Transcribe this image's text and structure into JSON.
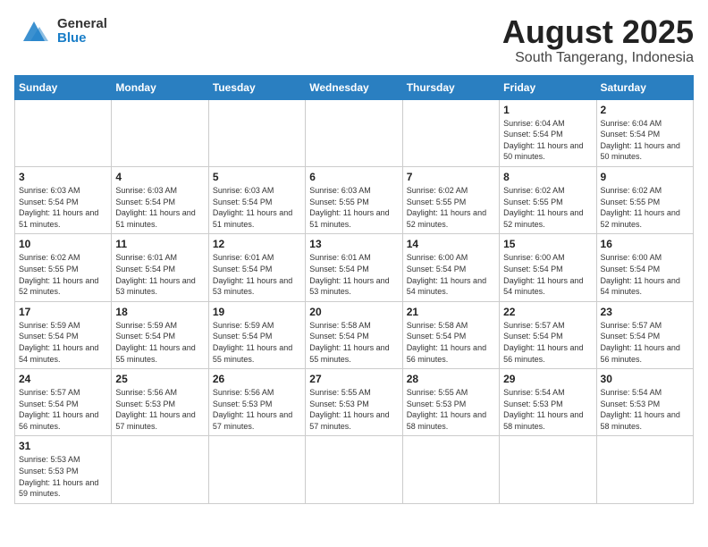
{
  "header": {
    "month": "August 2025",
    "location": "South Tangerang, Indonesia"
  },
  "logo": {
    "general": "General",
    "blue": "Blue"
  },
  "days": [
    "Sunday",
    "Monday",
    "Tuesday",
    "Wednesday",
    "Thursday",
    "Friday",
    "Saturday"
  ],
  "weeks": [
    [
      {
        "day": "",
        "info": ""
      },
      {
        "day": "",
        "info": ""
      },
      {
        "day": "",
        "info": ""
      },
      {
        "day": "",
        "info": ""
      },
      {
        "day": "",
        "info": ""
      },
      {
        "day": "1",
        "info": "Sunrise: 6:04 AM\nSunset: 5:54 PM\nDaylight: 11 hours\nand 50 minutes."
      },
      {
        "day": "2",
        "info": "Sunrise: 6:04 AM\nSunset: 5:54 PM\nDaylight: 11 hours\nand 50 minutes."
      }
    ],
    [
      {
        "day": "3",
        "info": "Sunrise: 6:03 AM\nSunset: 5:54 PM\nDaylight: 11 hours\nand 51 minutes."
      },
      {
        "day": "4",
        "info": "Sunrise: 6:03 AM\nSunset: 5:54 PM\nDaylight: 11 hours\nand 51 minutes."
      },
      {
        "day": "5",
        "info": "Sunrise: 6:03 AM\nSunset: 5:54 PM\nDaylight: 11 hours\nand 51 minutes."
      },
      {
        "day": "6",
        "info": "Sunrise: 6:03 AM\nSunset: 5:55 PM\nDaylight: 11 hours\nand 51 minutes."
      },
      {
        "day": "7",
        "info": "Sunrise: 6:02 AM\nSunset: 5:55 PM\nDaylight: 11 hours\nand 52 minutes."
      },
      {
        "day": "8",
        "info": "Sunrise: 6:02 AM\nSunset: 5:55 PM\nDaylight: 11 hours\nand 52 minutes."
      },
      {
        "day": "9",
        "info": "Sunrise: 6:02 AM\nSunset: 5:55 PM\nDaylight: 11 hours\nand 52 minutes."
      }
    ],
    [
      {
        "day": "10",
        "info": "Sunrise: 6:02 AM\nSunset: 5:55 PM\nDaylight: 11 hours\nand 52 minutes."
      },
      {
        "day": "11",
        "info": "Sunrise: 6:01 AM\nSunset: 5:54 PM\nDaylight: 11 hours\nand 53 minutes."
      },
      {
        "day": "12",
        "info": "Sunrise: 6:01 AM\nSunset: 5:54 PM\nDaylight: 11 hours\nand 53 minutes."
      },
      {
        "day": "13",
        "info": "Sunrise: 6:01 AM\nSunset: 5:54 PM\nDaylight: 11 hours\nand 53 minutes."
      },
      {
        "day": "14",
        "info": "Sunrise: 6:00 AM\nSunset: 5:54 PM\nDaylight: 11 hours\nand 54 minutes."
      },
      {
        "day": "15",
        "info": "Sunrise: 6:00 AM\nSunset: 5:54 PM\nDaylight: 11 hours\nand 54 minutes."
      },
      {
        "day": "16",
        "info": "Sunrise: 6:00 AM\nSunset: 5:54 PM\nDaylight: 11 hours\nand 54 minutes."
      }
    ],
    [
      {
        "day": "17",
        "info": "Sunrise: 5:59 AM\nSunset: 5:54 PM\nDaylight: 11 hours\nand 54 minutes."
      },
      {
        "day": "18",
        "info": "Sunrise: 5:59 AM\nSunset: 5:54 PM\nDaylight: 11 hours\nand 55 minutes."
      },
      {
        "day": "19",
        "info": "Sunrise: 5:59 AM\nSunset: 5:54 PM\nDaylight: 11 hours\nand 55 minutes."
      },
      {
        "day": "20",
        "info": "Sunrise: 5:58 AM\nSunset: 5:54 PM\nDaylight: 11 hours\nand 55 minutes."
      },
      {
        "day": "21",
        "info": "Sunrise: 5:58 AM\nSunset: 5:54 PM\nDaylight: 11 hours\nand 56 minutes."
      },
      {
        "day": "22",
        "info": "Sunrise: 5:57 AM\nSunset: 5:54 PM\nDaylight: 11 hours\nand 56 minutes."
      },
      {
        "day": "23",
        "info": "Sunrise: 5:57 AM\nSunset: 5:54 PM\nDaylight: 11 hours\nand 56 minutes."
      }
    ],
    [
      {
        "day": "24",
        "info": "Sunrise: 5:57 AM\nSunset: 5:54 PM\nDaylight: 11 hours\nand 56 minutes."
      },
      {
        "day": "25",
        "info": "Sunrise: 5:56 AM\nSunset: 5:53 PM\nDaylight: 11 hours\nand 57 minutes."
      },
      {
        "day": "26",
        "info": "Sunrise: 5:56 AM\nSunset: 5:53 PM\nDaylight: 11 hours\nand 57 minutes."
      },
      {
        "day": "27",
        "info": "Sunrise: 5:55 AM\nSunset: 5:53 PM\nDaylight: 11 hours\nand 57 minutes."
      },
      {
        "day": "28",
        "info": "Sunrise: 5:55 AM\nSunset: 5:53 PM\nDaylight: 11 hours\nand 58 minutes."
      },
      {
        "day": "29",
        "info": "Sunrise: 5:54 AM\nSunset: 5:53 PM\nDaylight: 11 hours\nand 58 minutes."
      },
      {
        "day": "30",
        "info": "Sunrise: 5:54 AM\nSunset: 5:53 PM\nDaylight: 11 hours\nand 58 minutes."
      }
    ],
    [
      {
        "day": "31",
        "info": "Sunrise: 5:53 AM\nSunset: 5:53 PM\nDaylight: 11 hours\nand 59 minutes."
      },
      {
        "day": "",
        "info": ""
      },
      {
        "day": "",
        "info": ""
      },
      {
        "day": "",
        "info": ""
      },
      {
        "day": "",
        "info": ""
      },
      {
        "day": "",
        "info": ""
      },
      {
        "day": "",
        "info": ""
      }
    ]
  ]
}
